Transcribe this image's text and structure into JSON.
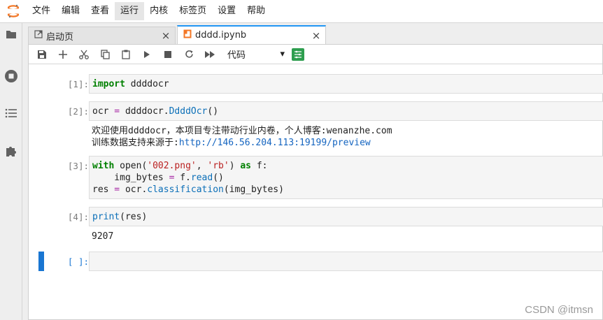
{
  "menubar": {
    "logo_icon": "jupyter-logo-icon",
    "items": [
      "文件",
      "编辑",
      "查看",
      "运行",
      "内核",
      "标签页",
      "设置",
      "帮助"
    ],
    "active_index": 3
  },
  "sidebar": {
    "icons": [
      "folder-icon",
      "stop-circle-icon",
      "list-icon",
      "puzzle-icon"
    ]
  },
  "tabs": [
    {
      "label": "启动页",
      "icon": "launcher-icon",
      "close": "×"
    },
    {
      "label": "dddd.ipynb",
      "icon": "notebook-icon",
      "close": "×"
    }
  ],
  "toolbar": {
    "buttons": [
      "save-icon",
      "add-icon",
      "cut-icon",
      "copy-icon",
      "paste-icon",
      "run-icon",
      "stop-icon",
      "restart-icon",
      "fast-forward-icon"
    ],
    "cell_type": "代码",
    "cell_type_arrow": "▾"
  },
  "cells": {
    "c1": {
      "prompt": "[1]:"
    },
    "c2": {
      "prompt": "[2]:",
      "output_line1": "欢迎使用ddddocr，本项目专注带动行业内卷，个人博客:wenanzhe.com",
      "output_line2_prefix": "训练数据支持来源于:",
      "output_link": "http://146.56.204.113:19199/preview"
    },
    "c3": {
      "prompt": "[3]:"
    },
    "c4": {
      "prompt": "[4]:",
      "output": "9207"
    },
    "c5": {
      "prompt": "[ ]:"
    }
  },
  "code": {
    "import_kw": "import",
    "import_mod": " ddddocr",
    "c2_var": "ocr",
    "c2_eq": " = ",
    "c2_mod": "ddddocr.",
    "c2_fn": "DdddOcr",
    "c2_args": "()",
    "c3_with": "with",
    "c3_open": " open",
    "c3_p1": "(",
    "c3_s1": "'002.png'",
    "c3_comma": ", ",
    "c3_s2": "'rb'",
    "c3_p2": ") ",
    "c3_as": "as",
    "c3_f": " f:",
    "c3_l2_var": "    img_bytes",
    "c3_l2_eq": " = ",
    "c3_l2_obj": "f.",
    "c3_l2_fn": "read",
    "c3_l2_args": "()",
    "c3_l3_var": "res",
    "c3_l3_eq": " = ",
    "c3_l3_obj": "ocr.",
    "c3_l3_fn": "classification",
    "c3_l3_args": "(img_bytes)",
    "c4_print": "print",
    "c4_args": "(res)"
  },
  "watermark": "CSDN @itmsn",
  "colors": {
    "accent": "#2196f3",
    "active_cell_bar": "#1976d2",
    "keyword": "#008000",
    "string": "#ba2121",
    "operator": "#a626a4",
    "function": "#0b6fb8",
    "link": "#1565c0"
  }
}
